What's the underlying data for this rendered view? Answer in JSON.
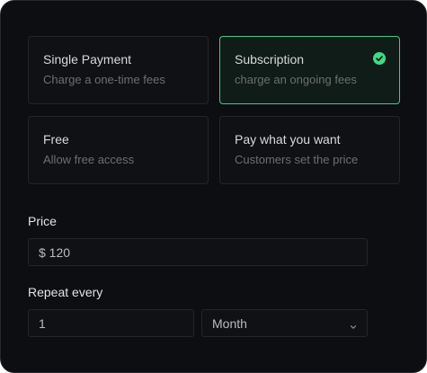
{
  "payment_options": [
    {
      "title": "Single Payment",
      "description": "Charge a one-time fees",
      "selected": false
    },
    {
      "title": "Subscription",
      "description": "charge an ongoing fees",
      "selected": true
    },
    {
      "title": "Free",
      "description": "Allow free access",
      "selected": false
    },
    {
      "title": "Pay what you want",
      "description": "Customers set the price",
      "selected": false
    }
  ],
  "price": {
    "label": "Price",
    "value": "$ 120"
  },
  "repeat": {
    "label": "Repeat every",
    "count": "1",
    "unit": "Month"
  },
  "colors": {
    "accent": "#3ddc84",
    "background": "#0d0e11"
  },
  "icons": {
    "selected": "check-circle-icon",
    "dropdown": "chevron-down-icon"
  }
}
